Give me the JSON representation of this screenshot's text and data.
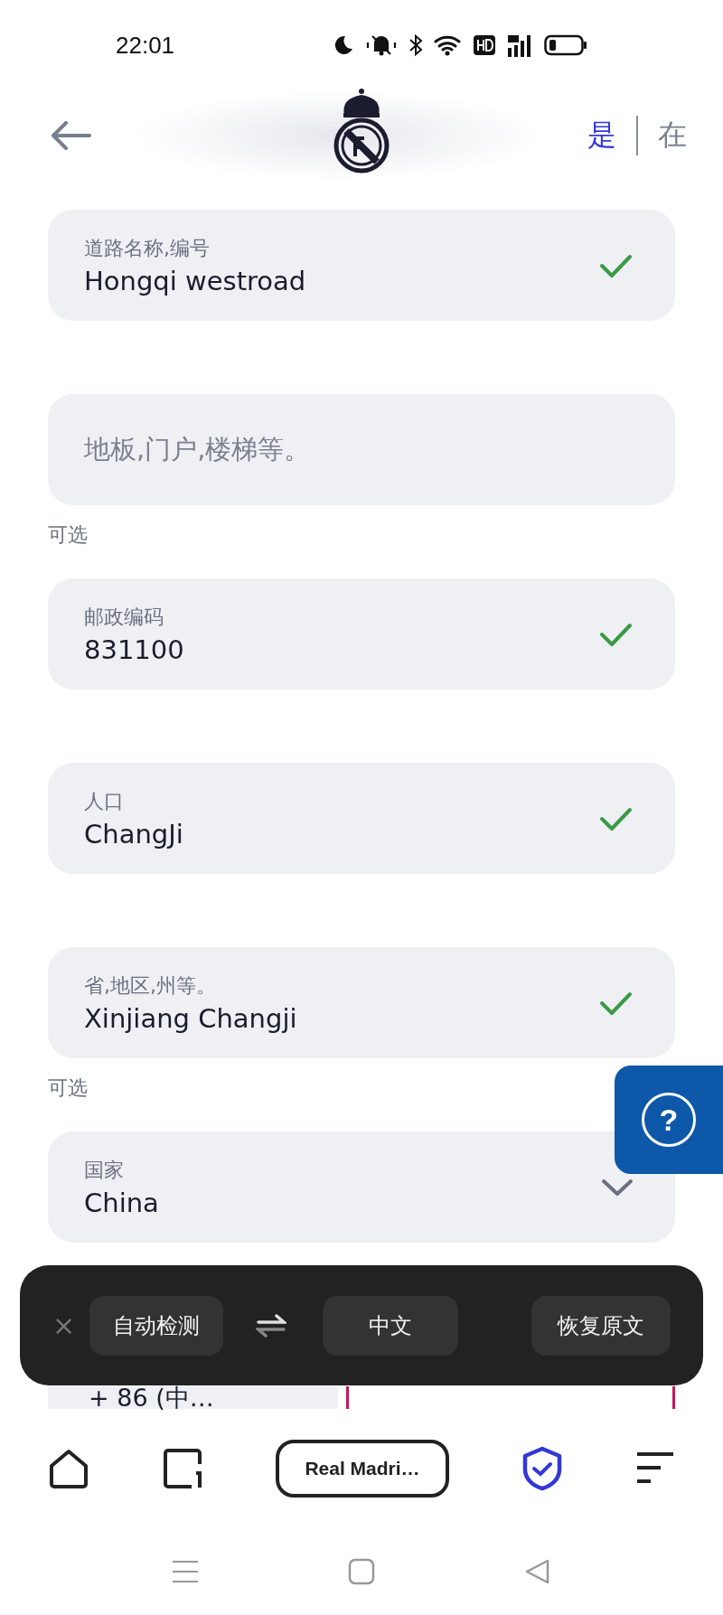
{
  "status_bar": {
    "time": "22:01"
  },
  "header": {
    "languages": [
      {
        "label": "是",
        "selected": true
      },
      {
        "label": "在",
        "selected": false
      }
    ]
  },
  "fields": [
    {
      "kind": "text",
      "label": "道路名称,编号",
      "value": "Hongqi westroad",
      "valid": true
    },
    {
      "kind": "text",
      "placeholder": "地板,门户,楼梯等。",
      "note": "可选"
    },
    {
      "kind": "text",
      "label": "邮政编码",
      "value": "831100",
      "valid": true
    },
    {
      "kind": "text",
      "label": "人口",
      "value": "ChangJi",
      "valid": true
    },
    {
      "kind": "text",
      "label": "省,地区,州等。",
      "value": "Xinjiang Changji",
      "valid": true,
      "note": "可选"
    },
    {
      "kind": "select",
      "label": "国家",
      "value": "China"
    }
  ],
  "phone": {
    "country_code": "+ 86 (中…"
  },
  "help_button": {
    "label": "?"
  },
  "translate_bar": {
    "close": "×",
    "source": "自动检测",
    "target": "中文",
    "restore": "恢复原文"
  },
  "bottom_nav": {
    "tab_title": "Real Madri…"
  }
}
